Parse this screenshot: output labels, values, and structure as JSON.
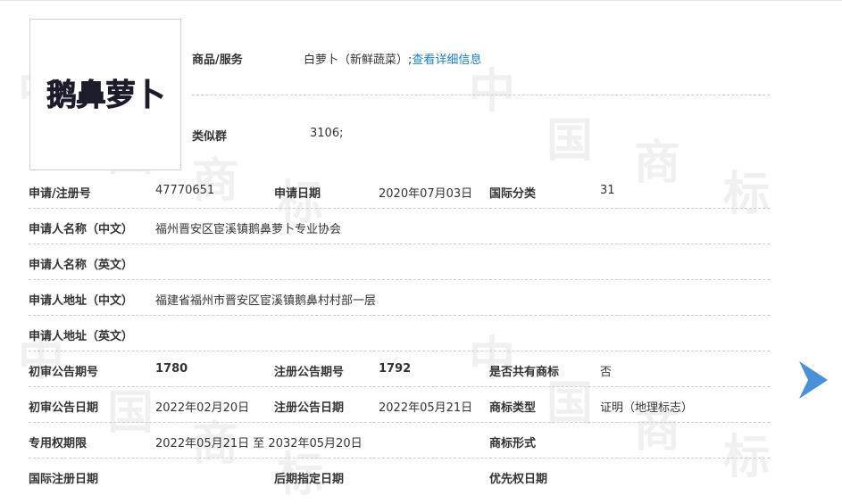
{
  "header": {
    "goods_label": "商品/服务",
    "goods_value": "白萝卜（新鲜蔬菜）;",
    "goods_link": "查看详细信息",
    "group_label": "类似群",
    "group_value": "3106;"
  },
  "logo": {
    "text": "鹅鼻萝卜"
  },
  "rows": {
    "reg_no_label": "申请/注册号",
    "reg_no_value": "47770651",
    "app_date_label": "申请日期",
    "app_date_value": "2020年07月03日",
    "intl_class_label": "国际分类",
    "intl_class_value": "31",
    "applicant_cn_label": "申请人名称（中文）",
    "applicant_cn_value": "福州晋安区宦溪镇鹅鼻萝卜专业协会",
    "applicant_en_label": "申请人名称（英文）",
    "address_cn_label": "申请人地址（中文）",
    "address_cn_value": "福建省福州市晋安区宦溪镇鹅鼻村村部一层",
    "address_en_label": "申请人地址（英文）",
    "prelim_no_label": "初审公告期号",
    "prelim_no_value": "1780",
    "reg_pub_no_label": "注册公告期号",
    "reg_pub_no_value": "1792",
    "shared_label": "是否共有商标",
    "shared_value": "否",
    "prelim_date_label": "初审公告日期",
    "prelim_date_value": "2022年02月20日",
    "reg_pub_date_label": "注册公告日期",
    "reg_pub_date_value": "2022年05月21日",
    "tm_type_label": "商标类型",
    "tm_type_value": "证明（地理标志）",
    "term_label": "专用权期限",
    "term_value": "2022年05月21日 至 2032年05月20日",
    "tm_form_label": "商标形式",
    "intl_reg_date_label": "国际注册日期",
    "late_date_label": "后期指定日期",
    "priority_date_label": "优先权日期"
  },
  "watermark": [
    "中",
    "国",
    "商",
    "标"
  ],
  "colors": {
    "link": "#1a7fc1",
    "arrow": "#4a90d9",
    "divider": "#cccccc"
  }
}
